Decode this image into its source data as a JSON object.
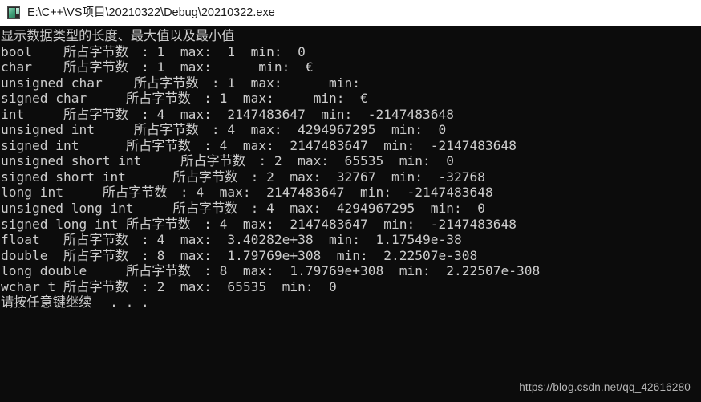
{
  "window": {
    "title": "E:\\C++\\VS项目\\20210322\\Debug\\20210322.exe",
    "icon": "console-window-icon",
    "titlebar_bg": "#ffffff",
    "title_color": "#1a1a1a"
  },
  "console": {
    "bg": "#0c0c0c",
    "fg": "#cccccc",
    "heading": "显示数据类型的长度、最大值以及最小值",
    "prompt": "请按任意键继续. . .",
    "labels": {
      "bytes": "所占字节数:",
      "max": "max:",
      "min": "min:"
    },
    "lines": [
      "显示数据类型的长度、最大值以及最小值",
      "bool    所占字节数: 1  max:  1  min:  0",
      "char    所占字节数: 1  max:      min:  €",
      "unsigned char    所占字节数: 1  max:      min: ",
      "signed char     所占字节数: 1  max:     min:  €",
      "int     所占字节数: 4  max:  2147483647  min:  -2147483648",
      "unsigned int     所占字节数: 4  max:  4294967295  min:  0",
      "signed int      所占字节数: 4  max:  2147483647  min:  -2147483648",
      "unsigned short int     所占字节数: 2  max:  65535  min:  0",
      "signed short int      所占字节数: 2  max:  32767  min:  -32768",
      "long int     所占字节数: 4  max:  2147483647  min:  -2147483648",
      "unsigned long int     所占字节数: 4  max:  4294967295  min:  0",
      "signed long int 所占字节数: 4  max:  2147483647  min:  -2147483648",
      "float   所占字节数: 4  max:  3.40282e+38  min:  1.17549e-38",
      "double  所占字节数: 8  max:  1.79769e+308  min:  2.22507e-308",
      "long double     所占字节数: 8  max:  1.79769e+308  min:  2.22507e-308",
      "wchar_t 所占字节数: 2  max:  65535  min:  0",
      "请按任意键继续. . ."
    ],
    "types": [
      {
        "name": "bool",
        "bytes": "1",
        "max": "1",
        "min": "0"
      },
      {
        "name": "char",
        "bytes": "1",
        "max": "",
        "min": "€"
      },
      {
        "name": "unsigned char",
        "bytes": "1",
        "max": "",
        "min": ""
      },
      {
        "name": "signed char",
        "bytes": "1",
        "max": "",
        "min": "€"
      },
      {
        "name": "int",
        "bytes": "4",
        "max": "2147483647",
        "min": "-2147483648"
      },
      {
        "name": "unsigned int",
        "bytes": "4",
        "max": "4294967295",
        "min": "0"
      },
      {
        "name": "signed int",
        "bytes": "4",
        "max": "2147483647",
        "min": "-2147483648"
      },
      {
        "name": "unsigned short int",
        "bytes": "2",
        "max": "65535",
        "min": "0"
      },
      {
        "name": "signed short int",
        "bytes": "2",
        "max": "32767",
        "min": "-32768"
      },
      {
        "name": "long int",
        "bytes": "4",
        "max": "2147483647",
        "min": "-2147483648"
      },
      {
        "name": "unsigned long int",
        "bytes": "4",
        "max": "4294967295",
        "min": "0"
      },
      {
        "name": "signed long int",
        "bytes": "4",
        "max": "2147483647",
        "min": "-2147483648"
      },
      {
        "name": "float",
        "bytes": "4",
        "max": "3.40282e+38",
        "min": "1.17549e-38"
      },
      {
        "name": "double",
        "bytes": "8",
        "max": "1.79769e+308",
        "min": "2.22507e-308"
      },
      {
        "name": "long double",
        "bytes": "8",
        "max": "1.79769e+308",
        "min": "2.22507e-308"
      },
      {
        "name": "wchar_t",
        "bytes": "2",
        "max": "65535",
        "min": "0"
      }
    ]
  },
  "watermark": {
    "text": "https://blog.csdn.net/qq_42616280",
    "color": "#b7b7b7"
  }
}
